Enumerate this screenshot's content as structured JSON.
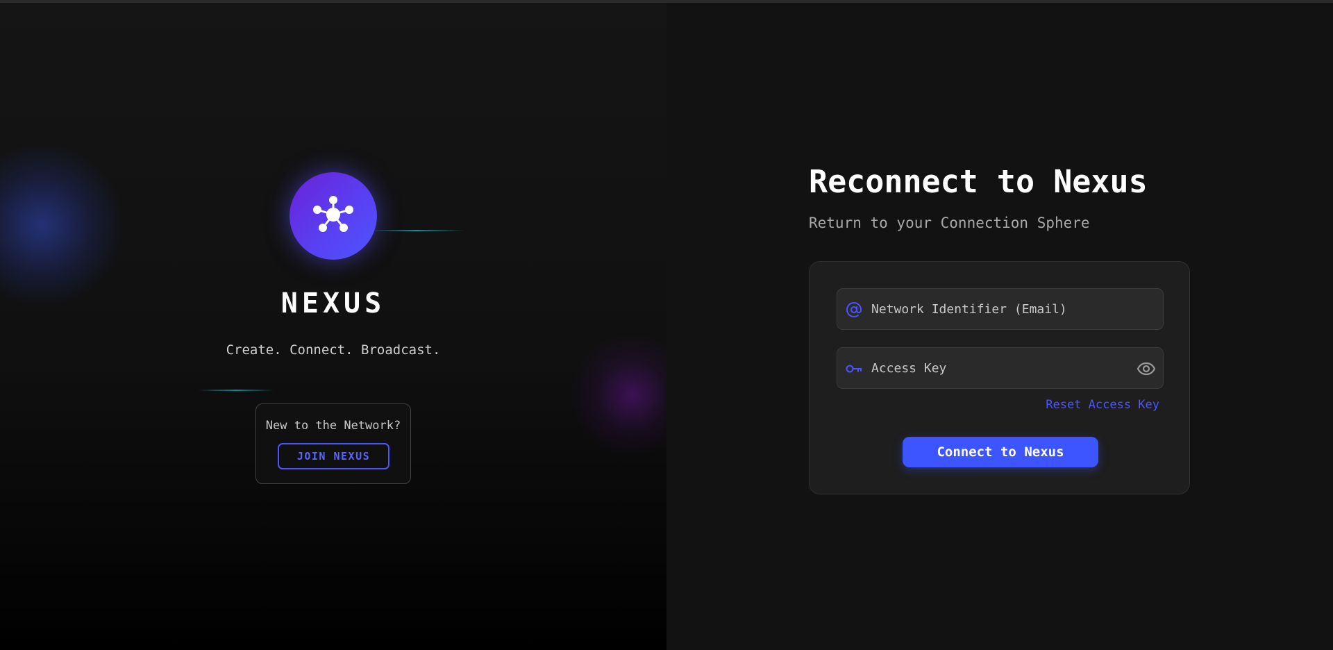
{
  "brand": {
    "name": "NEXUS",
    "tagline": "Create. Connect. Broadcast.",
    "logo_icon": "network-hub-icon"
  },
  "join": {
    "prompt": "New to the Network?",
    "button_label": "JOIN NEXUS"
  },
  "login": {
    "title": "Reconnect to Nexus",
    "subtitle": "Return to your Connection Sphere",
    "email": {
      "value": "",
      "placeholder": "Network Identifier (Email)",
      "icon": "at-sign-icon"
    },
    "access_key": {
      "value": "",
      "placeholder": "Access Key",
      "icon": "key-icon",
      "toggle_icon": "eye-icon"
    },
    "reset_link": "Reset Access Key",
    "submit_label": "Connect to Nexus"
  },
  "colors": {
    "accent": "#4a55ff",
    "button": "#3d55ff",
    "logo_gradient_start": "#6a22d8",
    "logo_gradient_end": "#4d56ff",
    "background": "#121212",
    "card": "#1e1e1e"
  }
}
